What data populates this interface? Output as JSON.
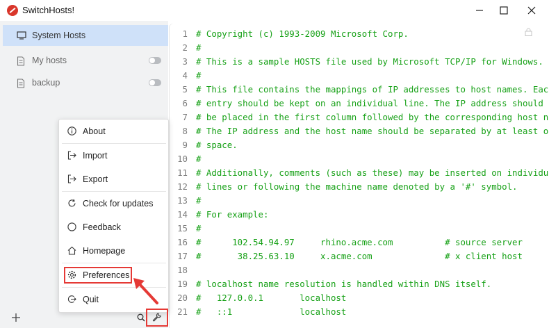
{
  "window": {
    "title": "SwitchHosts!",
    "controls": [
      "minimize-icon",
      "maximize-icon",
      "close-icon"
    ]
  },
  "sidebar": {
    "items": [
      {
        "label": "System Hosts",
        "icon": "monitor-icon",
        "active": true
      },
      {
        "label": "My hosts",
        "icon": "file-icon",
        "toggle": "off"
      },
      {
        "label": "backup",
        "icon": "file-icon",
        "toggle": "off"
      }
    ]
  },
  "menu": {
    "items": [
      {
        "label": "About",
        "icon": "info-icon"
      },
      {
        "label": "Import",
        "icon": "import-icon"
      },
      {
        "label": "Export",
        "icon": "export-icon"
      },
      {
        "label": "Check for updates",
        "icon": "refresh-icon"
      },
      {
        "label": "Feedback",
        "icon": "feedback-icon"
      },
      {
        "label": "Homepage",
        "icon": "home-icon"
      },
      {
        "label": "Preferences",
        "icon": "gear-icon",
        "highlighted": true
      },
      {
        "label": "Quit",
        "icon": "quit-icon"
      }
    ]
  },
  "bottombar": {
    "icons": [
      "plus-icon",
      "search-icon",
      "wrench-icon"
    ]
  },
  "editor": {
    "locked": true,
    "lines": [
      {
        "n": "1",
        "text": "# Copyright (c) 1993-2009 Microsoft Corp."
      },
      {
        "n": "2",
        "text": "#"
      },
      {
        "n": "3",
        "text": "# This is a sample HOSTS file used by Microsoft TCP/IP for Windows."
      },
      {
        "n": "4",
        "text": "#"
      },
      {
        "n": "5",
        "text": "# This file contains the mappings of IP addresses to host names. Each"
      },
      {
        "n": "6",
        "text": "# entry should be kept on an individual line. The IP address should"
      },
      {
        "n": "7",
        "text": "# be placed in the first column followed by the corresponding host nam"
      },
      {
        "n": "8",
        "text": "# The IP address and the host name should be separated by at least one"
      },
      {
        "n": "9",
        "text": "# space."
      },
      {
        "n": "10",
        "text": "#"
      },
      {
        "n": "11",
        "text": "# Additionally, comments (such as these) may be inserted on individual"
      },
      {
        "n": "12",
        "text": "# lines or following the machine name denoted by a '#' symbol."
      },
      {
        "n": "13",
        "text": "#"
      },
      {
        "n": "14",
        "text": "# For example:"
      },
      {
        "n": "15",
        "text": "#"
      },
      {
        "n": "16",
        "text": "#      102.54.94.97     rhino.acme.com          # source server"
      },
      {
        "n": "17",
        "text": "#       38.25.63.10     x.acme.com              # x client host"
      },
      {
        "n": "18",
        "text": ""
      },
      {
        "n": "19",
        "text": "# localhost name resolution is handled within DNS itself."
      },
      {
        "n": "20",
        "text": "#   127.0.0.1       localhost"
      },
      {
        "n": "21",
        "text": "#   ::1             localhost"
      }
    ]
  },
  "colors": {
    "accent_active": "#cfe1f9",
    "code_green": "#17a117",
    "highlight_red": "#e53935"
  }
}
